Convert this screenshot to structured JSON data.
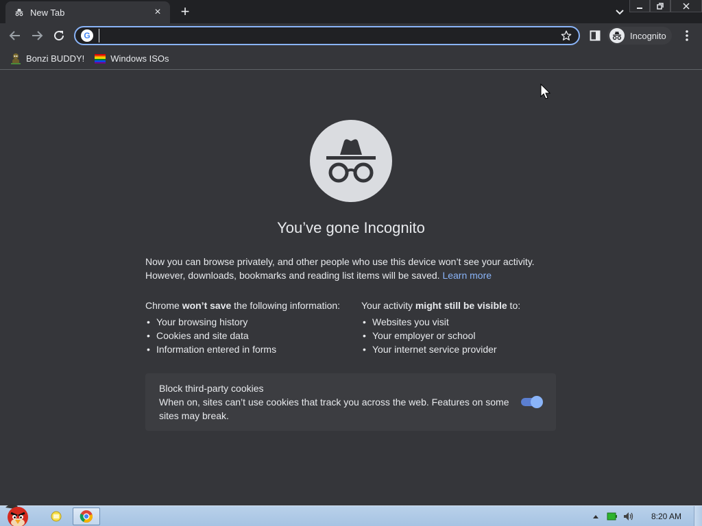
{
  "tab": {
    "title": "New Tab",
    "close_label": "×"
  },
  "toolbar": {
    "omnibox_value": "",
    "profile_label": "Incognito"
  },
  "bookmarks": [
    {
      "label": "Bonzi BUDDY!",
      "icon": "bonzi-icon"
    },
    {
      "label": "Windows ISOs",
      "icon": "rainbow-flag-icon"
    }
  ],
  "page": {
    "title": "You’ve gone Incognito",
    "intro_line1": "Now you can browse privately, and other people who use this device won’t see your activity.",
    "intro_line2": "However, downloads, bookmarks and reading list items will be saved.",
    "learn_more": "Learn more",
    "left_heading_pre": "Chrome ",
    "left_heading_bold": "won’t save",
    "left_heading_post": " the following information:",
    "left_items": [
      "Your browsing history",
      "Cookies and site data",
      "Information entered in forms"
    ],
    "right_heading_pre": "Your activity ",
    "right_heading_bold": "might still be visible",
    "right_heading_post": " to:",
    "right_items": [
      "Websites you visit",
      "Your employer or school",
      "Your internet service provider"
    ],
    "cookie_title": "Block third-party cookies",
    "cookie_desc": "When on, sites can’t use cookies that track you across the web. Features on some sites may break.",
    "cookie_toggle_on": true
  },
  "taskbar": {
    "clock": "8:20 AM"
  },
  "colors": {
    "accent": "#8ab4f8",
    "background": "#35363a",
    "tabstrip": "#202124"
  }
}
